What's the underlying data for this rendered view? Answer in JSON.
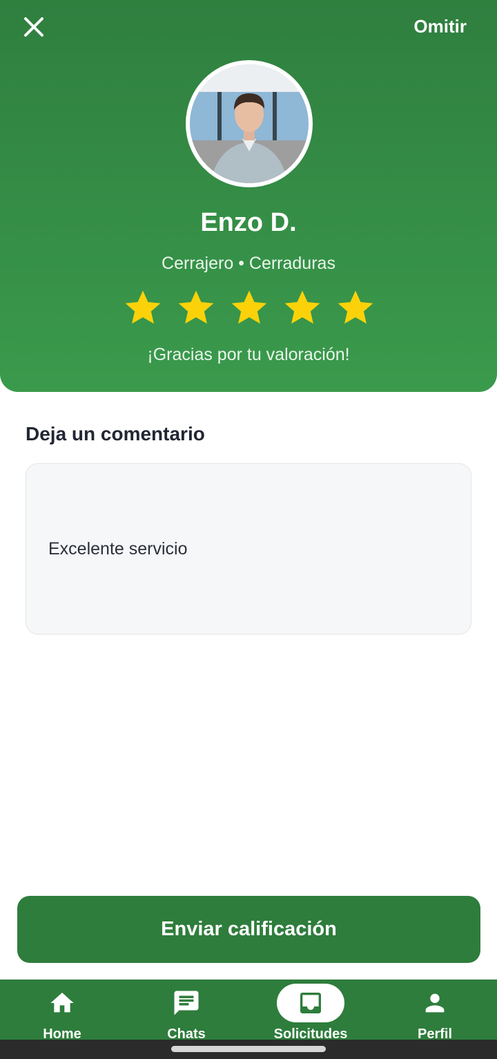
{
  "header": {
    "close_icon": "close-icon",
    "skip_label": "Omitir",
    "provider_name": "Enzo D.",
    "provider_role": "Cerrajero • Cerraduras",
    "rating": 5,
    "rating_max": 5,
    "thanks_message": "¡Gracias por tu valoración!",
    "background_color": "#3a9a4c",
    "star_color": "#fbd20a"
  },
  "comment": {
    "section_title": "Deja un comentario",
    "value": "Excelente servicio"
  },
  "submit": {
    "label": "Enviar calificación",
    "color": "#2e7d3c"
  },
  "bottom_nav": {
    "items": [
      {
        "label": "Home",
        "icon": "home-icon",
        "active": false
      },
      {
        "label": "Chats",
        "icon": "chat-icon",
        "active": false
      },
      {
        "label": "Solicitudes",
        "icon": "inbox-icon",
        "active": true
      },
      {
        "label": "Perfil",
        "icon": "person-icon",
        "active": false
      }
    ]
  }
}
